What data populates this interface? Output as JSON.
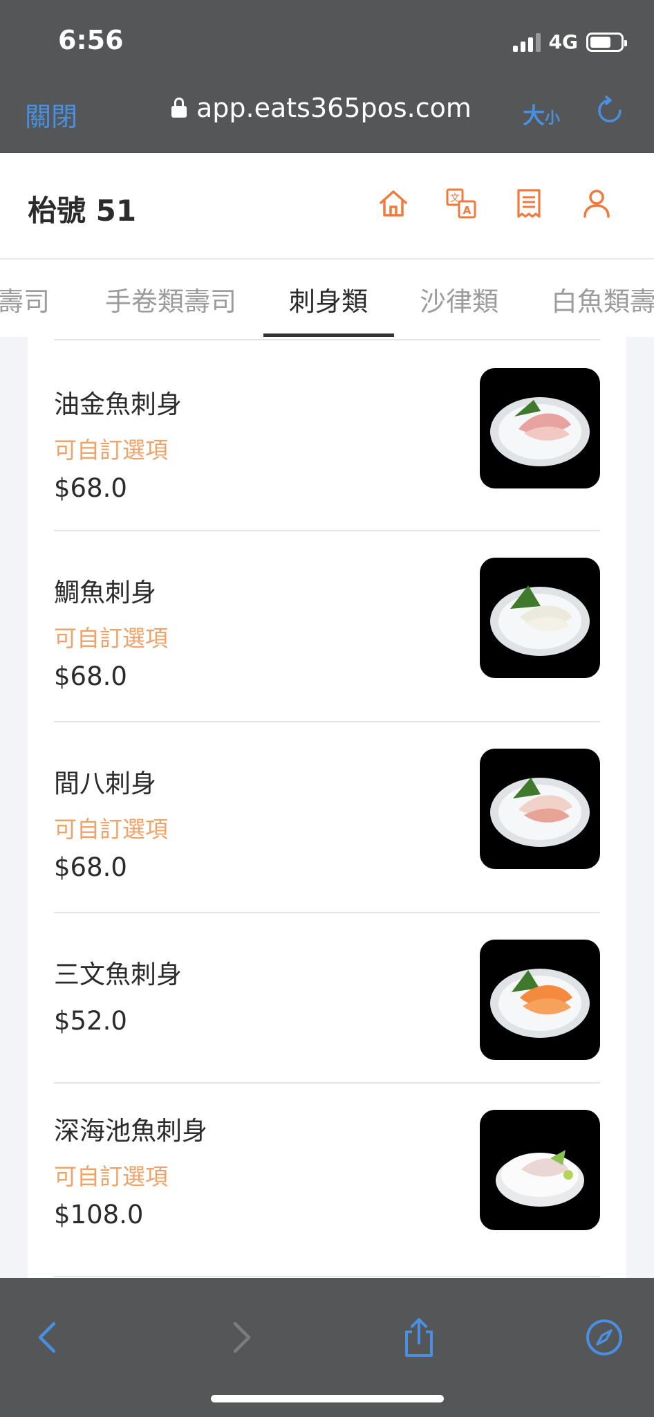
{
  "status": {
    "time": "6:56",
    "network": "4G"
  },
  "browser": {
    "close_label": "關閉",
    "url": "app.eats365pos.com",
    "size_big": "大",
    "size_small": "小"
  },
  "app": {
    "table_title": "枱號 51",
    "icons": [
      "home-icon",
      "translate-icon",
      "receipt-icon",
      "user-icon"
    ],
    "accent_color": "#f07a3c"
  },
  "tabs": [
    {
      "label": "壽司",
      "active": false
    },
    {
      "label": "手卷類壽司",
      "active": false
    },
    {
      "label": "刺身類",
      "active": true
    },
    {
      "label": "沙律類",
      "active": false
    },
    {
      "label": "白魚類壽司",
      "active": false
    }
  ],
  "menu_items": [
    {
      "name": "油金魚刺身",
      "option": "可自訂選項",
      "price": "$68.0"
    },
    {
      "name": "鯛魚刺身",
      "option": "可自訂選項",
      "price": "$68.0"
    },
    {
      "name": "間八刺身",
      "option": "可自訂選項",
      "price": "$68.0"
    },
    {
      "name": "三文魚刺身",
      "option": "",
      "price": "$52.0"
    },
    {
      "name": "深海池魚刺身",
      "option": "可自訂選項",
      "price": "$108.0"
    }
  ],
  "toolbar": {
    "icons": [
      "back-icon",
      "forward-icon",
      "share-icon",
      "compass-icon"
    ]
  }
}
